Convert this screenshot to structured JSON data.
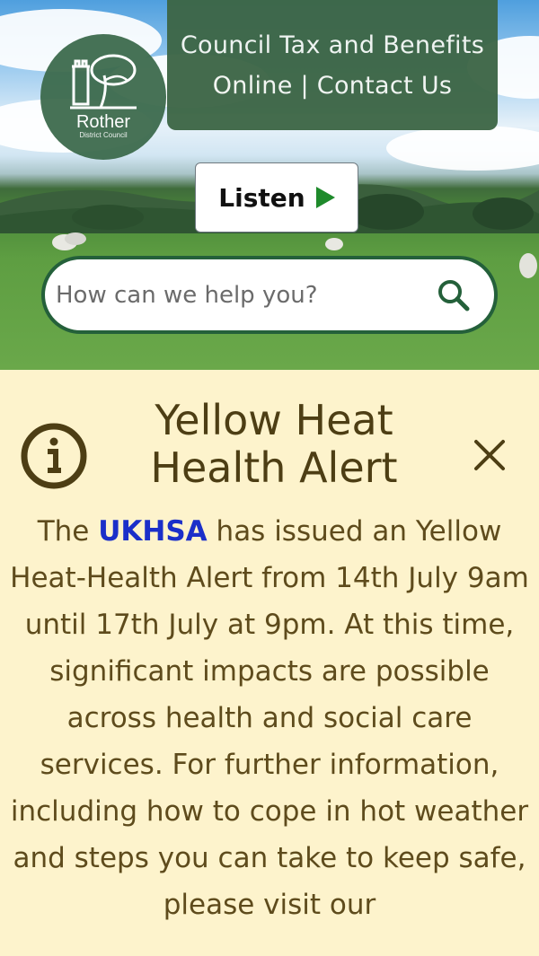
{
  "header": {
    "logo_title": "Rother",
    "logo_subtitle": "District Council",
    "top_link": "Council Tax and Benefits Online | Contact Us",
    "listen_label": "Listen"
  },
  "search": {
    "placeholder": "How can we help you?"
  },
  "alert": {
    "title": "Yellow Heat Health Alert",
    "body_prefix": "The ",
    "body_link": "UKHSA",
    "body_suffix": " has issued an Yellow Heat-Health Alert from 14th July 9am until 17th July at 9pm. At this time, significant impacts are possible across health and social care services. For further information, including how to cope in hot weather and steps you can take to keep safe, please visit our"
  },
  "colors": {
    "brand_green": "#3d6646",
    "search_border": "#24603a",
    "alert_background": "#fdf3cc",
    "alert_text": "#5e4b1c",
    "link_blue": "#1b2fc9",
    "listen_play": "#1e8a2b"
  },
  "icons": {
    "logo": "council-logo",
    "play": "play-icon",
    "search": "search-icon",
    "info": "info-icon",
    "close": "close-icon"
  }
}
